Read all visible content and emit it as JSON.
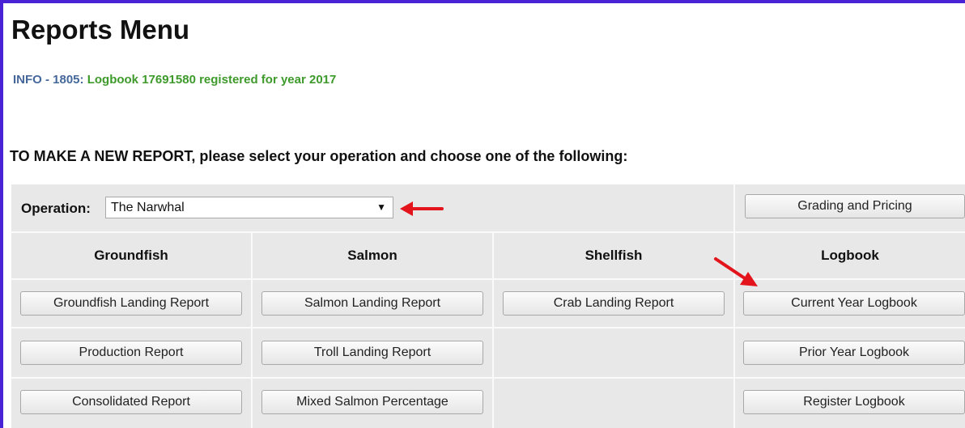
{
  "page": {
    "title": "Reports Menu",
    "info_code": "INFO - 1805:",
    "info_message": "Logbook 17691580 registered for year 2017",
    "instruction": "TO MAKE A NEW REPORT, please select your operation and choose one of the following:"
  },
  "operation": {
    "label": "Operation:",
    "selected": "The Narwhal",
    "dropdown_icon": "▼"
  },
  "grading_button": "Grading and Pricing",
  "columns": [
    {
      "header": "Groundfish",
      "buttons": [
        "Groundfish Landing Report",
        "Production Report",
        "Consolidated Report"
      ]
    },
    {
      "header": "Salmon",
      "buttons": [
        "Salmon Landing Report",
        "Troll Landing Report",
        "Mixed Salmon Percentage"
      ]
    },
    {
      "header": "Shellfish",
      "buttons": [
        "Crab Landing Report"
      ]
    },
    {
      "header": "Logbook",
      "buttons": [
        "Current Year Logbook",
        "Prior Year Logbook",
        "Register Logbook"
      ]
    }
  ],
  "colors": {
    "frame": "#4a22d6",
    "info_code": "#45679a",
    "info_message": "#3e9a2b",
    "annotation_arrow": "#e3141b"
  }
}
